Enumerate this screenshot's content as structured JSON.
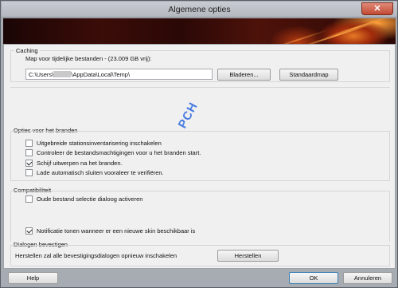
{
  "window": {
    "title": "Algemene opties",
    "close_glyph": "✕"
  },
  "caching": {
    "group_label": "Caching",
    "path_label": "Map voor tijdelijke bestanden - (23.009  GB vrij):",
    "path_prefix": "C:\\Users\\",
    "path_suffix": "\\AppData\\Local\\Temp\\",
    "browse_label": "Bladeren...",
    "default_label": "Standaardmap"
  },
  "burn_options": {
    "group_label": "Opties voor het branden",
    "items": [
      {
        "label": "Uitgebreide stationsinventarisering inschakelen",
        "checked": false
      },
      {
        "label": "Controleer de bestandsmachtigingen voor u het branden start.",
        "checked": false
      },
      {
        "label": "Schijf uitwerpen na het branden.",
        "checked": true
      },
      {
        "label": "Lade automatisch sluiten vooraleer te verifiëren.",
        "checked": false
      }
    ]
  },
  "compatibility": {
    "group_label": "Compatibiliteit",
    "items": [
      {
        "label": "Oude bestand selectie dialoog activeren",
        "checked": false
      },
      {
        "label": "Notificatie tonen wanneer er een nieuwe skin beschikbaar is",
        "checked": true
      }
    ]
  },
  "dialogs": {
    "group_label": "Dialogen bevestigen",
    "description": "Herstellen zal alle bevestigingsdialogen opnieuw inschakelen",
    "reset_label": "Herstellen"
  },
  "footer": {
    "help_label": "Help",
    "ok_label": "OK",
    "cancel_label": "Annuleren"
  },
  "watermark": "PCH",
  "colors": {
    "banner_fire": "#e67a25",
    "close_button": "#c14a34",
    "content_bg": "#f0f0f0"
  }
}
